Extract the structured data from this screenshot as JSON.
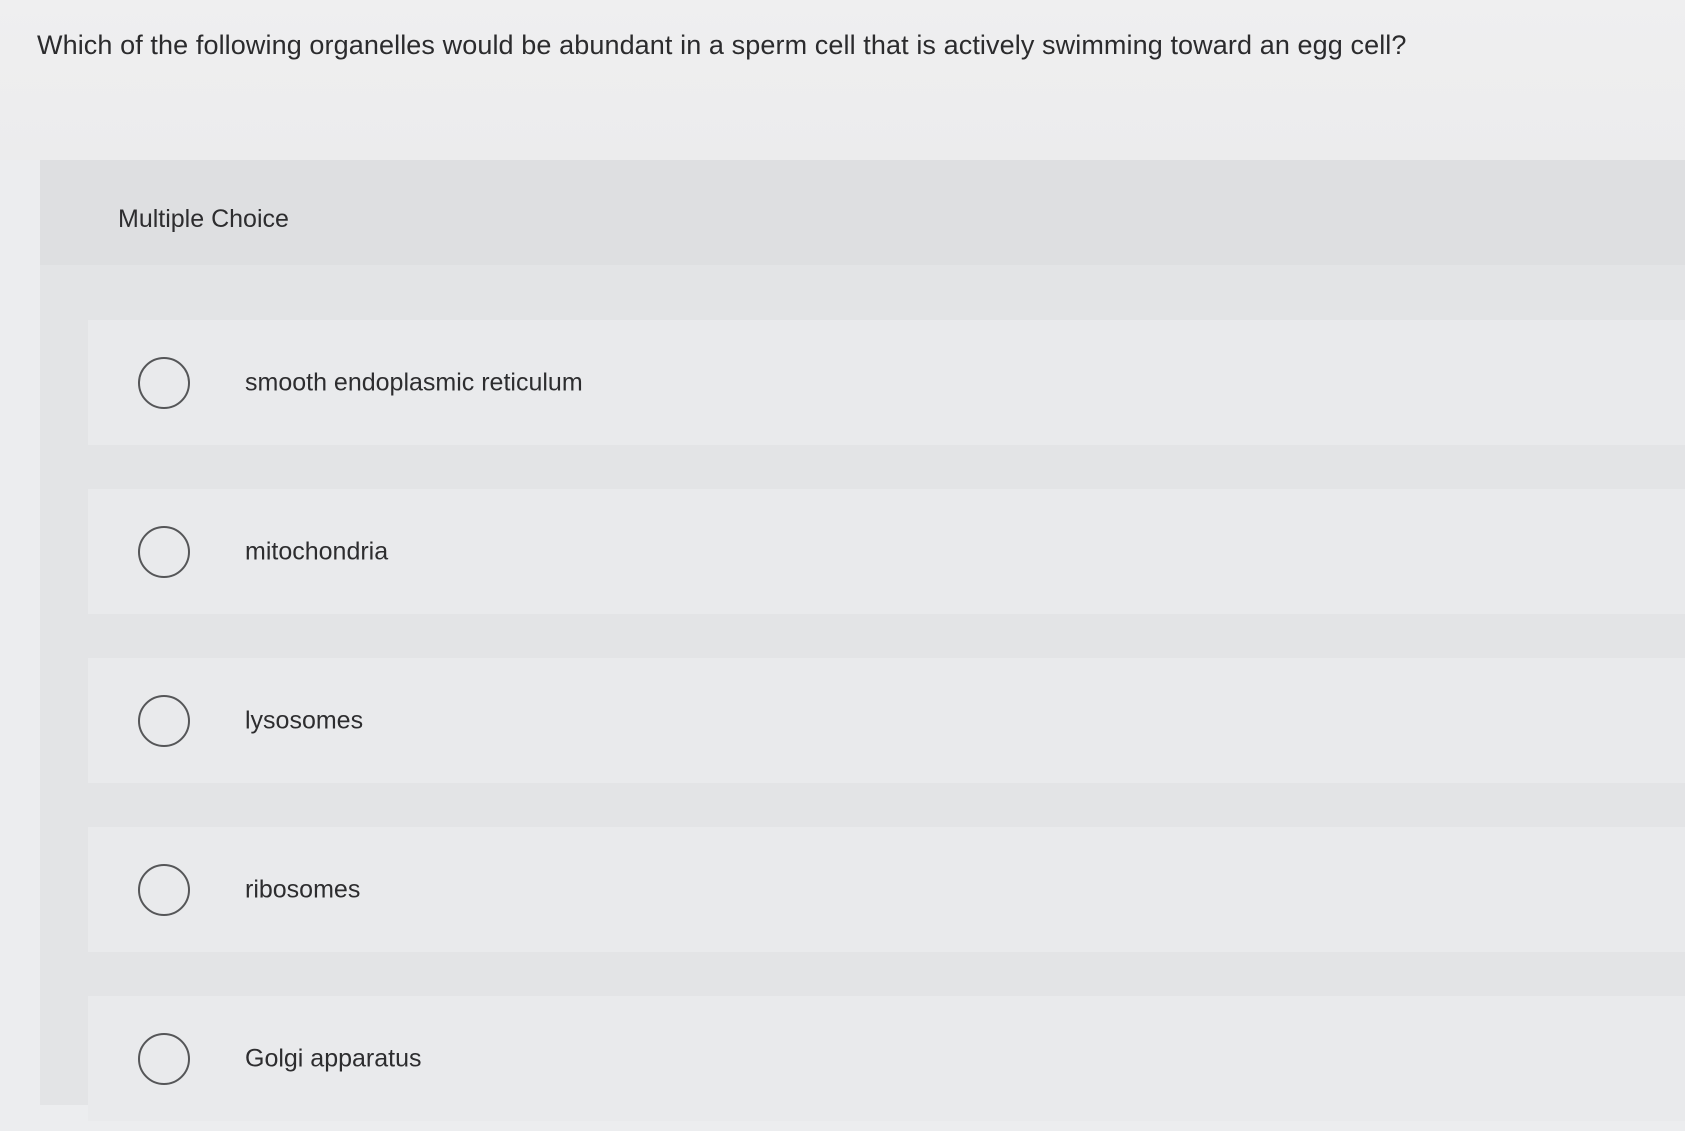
{
  "question": {
    "text": "Which of the following organelles would be abundant in a sperm cell that is actively swimming toward an egg cell?"
  },
  "multiple_choice": {
    "label": "Multiple Choice",
    "options": [
      {
        "label": "smooth endoplasmic reticulum",
        "selected": false
      },
      {
        "label": "mitochondria",
        "selected": false
      },
      {
        "label": "lysosomes",
        "selected": false
      },
      {
        "label": "ribosomes",
        "selected": false
      },
      {
        "label": "Golgi apparatus",
        "selected": false
      }
    ]
  },
  "colors": {
    "page_background": "#ecedef",
    "panel_background": "#e3e4e6",
    "option_background": "#e9eaec",
    "text": "#2d2d2f",
    "radio_border": "#555658"
  }
}
